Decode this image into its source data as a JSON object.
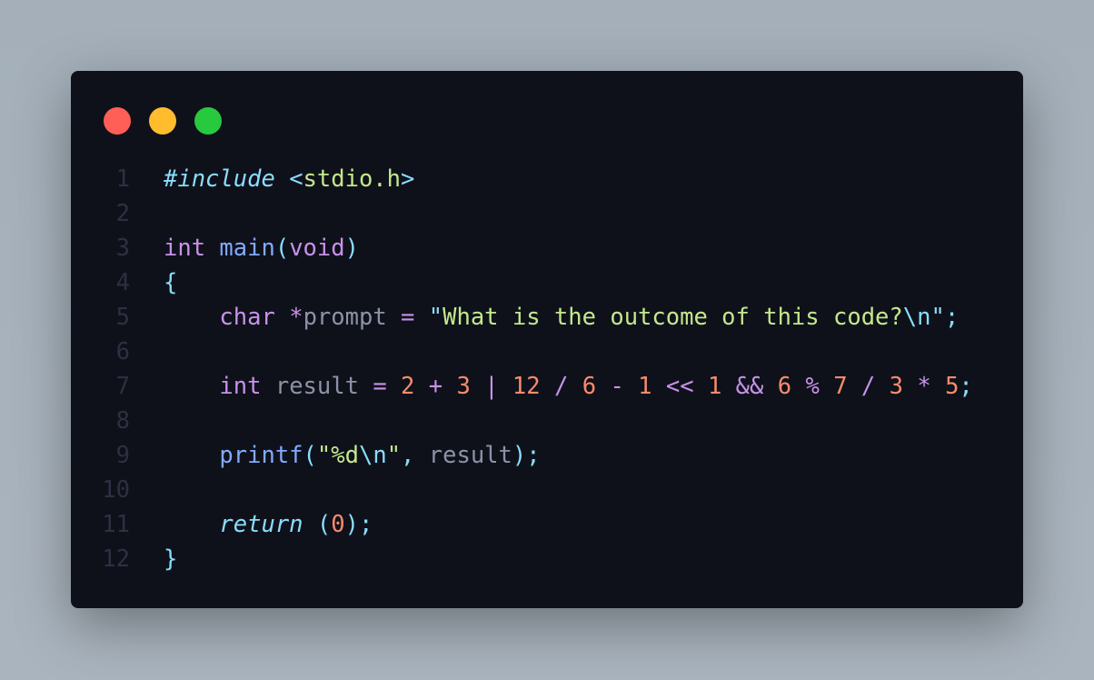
{
  "window_controls": {
    "close_color": "#ff5f56",
    "minimize_color": "#ffbd2e",
    "maximize_color": "#27c93f"
  },
  "code_lines": [
    {
      "number": "1",
      "tokens": [
        [
          "#include",
          "pre"
        ],
        [
          " ",
          "ws"
        ],
        [
          "<",
          "pn"
        ],
        [
          "stdio.h",
          "str"
        ],
        [
          ">",
          "pn"
        ]
      ]
    },
    {
      "number": "2",
      "tokens": []
    },
    {
      "number": "3",
      "tokens": [
        [
          "int",
          "kw"
        ],
        [
          " ",
          "ws"
        ],
        [
          "main",
          "fn"
        ],
        [
          "(",
          "pn"
        ],
        [
          "void",
          "kw"
        ],
        [
          ")",
          "pn"
        ]
      ]
    },
    {
      "number": "4",
      "tokens": [
        [
          "{",
          "pn"
        ]
      ]
    },
    {
      "number": "5",
      "tokens": [
        [
          "    ",
          "ws"
        ],
        [
          "char",
          "kw"
        ],
        [
          " ",
          "ws"
        ],
        [
          "*",
          "op"
        ],
        [
          "prompt",
          "var"
        ],
        [
          " ",
          "ws"
        ],
        [
          "=",
          "op"
        ],
        [
          " ",
          "ws"
        ],
        [
          "\"",
          "pn"
        ],
        [
          "What is the outcome of this code?",
          "str"
        ],
        [
          "\\n",
          "pn"
        ],
        [
          "\"",
          "pn"
        ],
        [
          ";",
          "pn"
        ]
      ]
    },
    {
      "number": "6",
      "tokens": []
    },
    {
      "number": "7",
      "tokens": [
        [
          "    ",
          "ws"
        ],
        [
          "int",
          "kw"
        ],
        [
          " ",
          "ws"
        ],
        [
          "result",
          "var"
        ],
        [
          " ",
          "ws"
        ],
        [
          "=",
          "op"
        ],
        [
          " ",
          "ws"
        ],
        [
          "2",
          "num"
        ],
        [
          " ",
          "ws"
        ],
        [
          "+",
          "op"
        ],
        [
          " ",
          "ws"
        ],
        [
          "3",
          "num"
        ],
        [
          " ",
          "ws"
        ],
        [
          "|",
          "op"
        ],
        [
          " ",
          "ws"
        ],
        [
          "12",
          "num"
        ],
        [
          " ",
          "ws"
        ],
        [
          "/",
          "op"
        ],
        [
          " ",
          "ws"
        ],
        [
          "6",
          "num"
        ],
        [
          " ",
          "ws"
        ],
        [
          "-",
          "op"
        ],
        [
          " ",
          "ws"
        ],
        [
          "1",
          "num"
        ],
        [
          " ",
          "ws"
        ],
        [
          "<<",
          "op"
        ],
        [
          " ",
          "ws"
        ],
        [
          "1",
          "num"
        ],
        [
          " ",
          "ws"
        ],
        [
          "&&",
          "op"
        ],
        [
          " ",
          "ws"
        ],
        [
          "6",
          "num"
        ],
        [
          " ",
          "ws"
        ],
        [
          "%",
          "op"
        ],
        [
          " ",
          "ws"
        ],
        [
          "7",
          "num"
        ],
        [
          " ",
          "ws"
        ],
        [
          "/",
          "op"
        ],
        [
          " ",
          "ws"
        ],
        [
          "3",
          "num"
        ],
        [
          " ",
          "ws"
        ],
        [
          "*",
          "op"
        ],
        [
          " ",
          "ws"
        ],
        [
          "5",
          "num"
        ],
        [
          ";",
          "pn"
        ]
      ]
    },
    {
      "number": "8",
      "tokens": []
    },
    {
      "number": "9",
      "tokens": [
        [
          "    ",
          "ws"
        ],
        [
          "printf",
          "fn"
        ],
        [
          "(",
          "pn"
        ],
        [
          "\"%d",
          "str"
        ],
        [
          "\\n",
          "pn"
        ],
        [
          "\"",
          "str"
        ],
        [
          ", ",
          "pn"
        ],
        [
          "result",
          "var"
        ],
        [
          ")",
          "pn"
        ],
        [
          ";",
          "pn"
        ]
      ]
    },
    {
      "number": "10",
      "tokens": []
    },
    {
      "number": "11",
      "tokens": [
        [
          "    ",
          "ws"
        ],
        [
          "return",
          "it"
        ],
        [
          " ",
          "ws"
        ],
        [
          "(",
          "pn"
        ],
        [
          "0",
          "num"
        ],
        [
          ")",
          "pn"
        ],
        [
          ";",
          "pn"
        ]
      ]
    },
    {
      "number": "12",
      "tokens": [
        [
          "}",
          "pn"
        ]
      ]
    }
  ]
}
